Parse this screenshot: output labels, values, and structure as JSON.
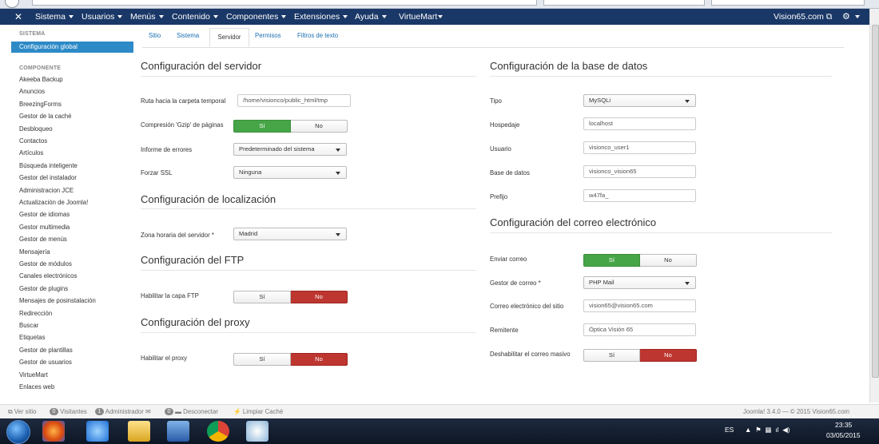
{
  "navbar": {
    "menus": [
      "Sistema",
      "Usuarios",
      "Menús",
      "Contenido",
      "Componentes",
      "Extensiones",
      "Ayuda",
      "VirtueMart"
    ],
    "site_name": "Vision65.com",
    "colors": {
      "bar": "#1a3867"
    }
  },
  "sidebar": {
    "system_header": "SISTEMA",
    "active_item": "Configuración global",
    "component_header": "COMPONENTE",
    "items": [
      "Akeeba Backup",
      "Anuncios",
      "BreezingForms",
      "Gestor de la caché",
      "Desbloqueo",
      "Contactos",
      "Artículos",
      "Búsqueda inteligente",
      "Gestor del instalador",
      "Administracion JCE",
      "Actualización de Joomla!",
      "Gestor de idiomas",
      "Gestor multimedia",
      "Gestor de menús",
      "Mensajería",
      "Gestor de módulos",
      "Canales electrónicos",
      "Gestor de plugins",
      "Mensajes de posinstalación",
      "Redirección",
      "Buscar",
      "Etiquetas",
      "Gestor de plantillas",
      "Gestor de usuarios",
      "VirtueMart",
      "Enlaces web"
    ]
  },
  "tabs": [
    "Sitio",
    "Sistema",
    "Servidor",
    "Permisos",
    "Filtros de texto"
  ],
  "server": {
    "title": "Configuración del servidor",
    "tmp_label": "Ruta hacia la carpeta temporal",
    "tmp_value": "/home/visionco/public_html/tmp",
    "gzip_label": "Compresión 'Gzip' de páginas",
    "errors_label": "Informe de errores",
    "errors_value": "Predeterminado del sistema",
    "ssl_label": "Forzar SSL",
    "ssl_value": "Ninguna"
  },
  "locale": {
    "title": "Configuración de localización",
    "tz_label": "Zona horaria del servidor *",
    "tz_value": "Madrid"
  },
  "ftp": {
    "title": "Configuración del FTP",
    "enable_label": "Habilitar la capa FTP"
  },
  "proxy": {
    "title": "Configuración del proxy",
    "enable_label": "Habilitar el proxy"
  },
  "database": {
    "title": "Configuración de la base de datos",
    "type_label": "Tipo",
    "type_value": "MySQLi",
    "host_label": "Hospedaje",
    "host_value": "localhost",
    "user_label": "Usuario",
    "user_value": "visionco_user1",
    "db_label": "Base de datos",
    "db_value": "visionco_vision65",
    "prefix_label": "Prefijo",
    "prefix_value": "w47fa_"
  },
  "mail": {
    "title": "Configuración del correo electrónico",
    "send_label": "Enviar correo",
    "manager_label": "Gestor de correo *",
    "manager_value": "PHP Mail",
    "from_label": "Correo electrónico del sitio",
    "from_value": "vision65@vision65.com",
    "sender_label": "Remitente",
    "sender_value": "Óptica Visión 65",
    "mass_label": "Deshabilitar el correo masivo"
  },
  "toggle": {
    "yes": "Sí",
    "no": "No"
  },
  "statusbar": {
    "view_site": "Ver sitio",
    "visitors_count": "0",
    "visitors": "Visitantes",
    "admin_count": "1",
    "admin": "Administrador",
    "msg_count": "0",
    "logout": "Desconectar",
    "clear_cache": "Limpiar Caché",
    "version": "Joomla! 3.4.0 — © 2015 Vision65.com"
  },
  "taskbar": {
    "lang": "ES",
    "time": "23:35",
    "date": "03/05/2015"
  }
}
